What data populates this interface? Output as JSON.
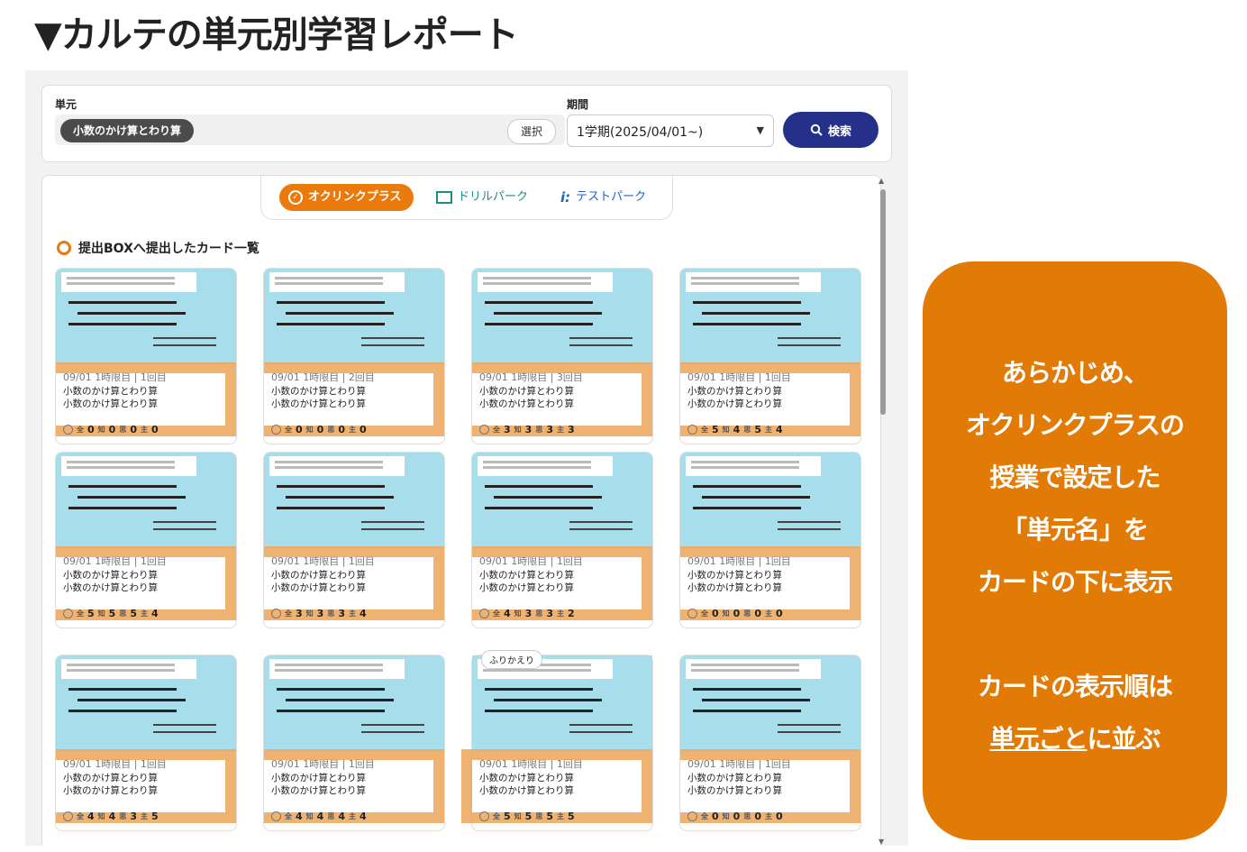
{
  "page_title": "▼カルテの単元別学習レポート",
  "search": {
    "unit_label": "単元",
    "unit_chip": "小数のかけ算とわり算",
    "select_button": "選択",
    "period_label": "期間",
    "period_value": "1学期(2025/04/01~)",
    "search_button": "検索"
  },
  "tabs": [
    {
      "label": "オクリンクプラス",
      "active": true
    },
    {
      "label": "ドリルパーク",
      "active": false
    },
    {
      "label": "テストパーク",
      "active": false
    }
  ],
  "section_title": "提出BOXへ提出したカード一覧",
  "score_labels": {
    "all": "全",
    "chi": "知",
    "shi": "思",
    "shu": "主"
  },
  "cards": [
    {
      "meta": "09/01 1時限目 | 1回目",
      "unit1": "小数のかけ算とわり算",
      "unit2": "小数のかけ算とわり算",
      "s_all": "0",
      "s_chi": "0",
      "s_shi": "0",
      "s_shu": "0"
    },
    {
      "meta": "09/01 1時限目 | 2回目",
      "unit1": "小数のかけ算とわり算",
      "unit2": "小数のかけ算とわり算",
      "s_all": "0",
      "s_chi": "0",
      "s_shi": "0",
      "s_shu": "0"
    },
    {
      "meta": "09/01 1時限目 | 3回目",
      "unit1": "小数のかけ算とわり算",
      "unit2": "小数のかけ算とわり算",
      "s_all": "3",
      "s_chi": "3",
      "s_shi": "3",
      "s_shu": "3"
    },
    {
      "meta": "09/01 1時限目 | 1回目",
      "unit1": "小数のかけ算とわり算",
      "unit2": "小数のかけ算とわり算",
      "s_all": "5",
      "s_chi": "4",
      "s_shi": "5",
      "s_shu": "4"
    },
    {
      "meta": "09/01 1時限目 | 1回目",
      "unit1": "小数のかけ算とわり算",
      "unit2": "小数のかけ算とわり算",
      "s_all": "5",
      "s_chi": "5",
      "s_shi": "5",
      "s_shu": "4"
    },
    {
      "meta": "09/01 1時限目 | 1回目",
      "unit1": "小数のかけ算とわり算",
      "unit2": "小数のかけ算とわり算",
      "s_all": "3",
      "s_chi": "3",
      "s_shi": "3",
      "s_shu": "4"
    },
    {
      "meta": "09/01 1時限目 | 1回目",
      "unit1": "小数のかけ算とわり算",
      "unit2": "小数のかけ算とわり算",
      "s_all": "4",
      "s_chi": "3",
      "s_shi": "3",
      "s_shu": "2"
    },
    {
      "meta": "09/01 1時限目 | 1回目",
      "unit1": "小数のかけ算とわり算",
      "unit2": "小数のかけ算とわり算",
      "s_all": "0",
      "s_chi": "0",
      "s_shi": "0",
      "s_shu": "0"
    },
    {
      "meta": "09/01 1時限目 | 1回目",
      "unit1": "小数のかけ算とわり算",
      "unit2": "小数のかけ算とわり算",
      "s_all": "4",
      "s_chi": "4",
      "s_shi": "3",
      "s_shu": "5"
    },
    {
      "meta": "09/01 1時限目 | 1回目",
      "unit1": "小数のかけ算とわり算",
      "unit2": "小数のかけ算とわり算",
      "s_all": "4",
      "s_chi": "4",
      "s_shi": "4",
      "s_shu": "4"
    },
    {
      "meta": "09/01 1時限目 | 1回目",
      "unit1": "小数のかけ算とわり算",
      "unit2": "小数のかけ算とわり算",
      "s_all": "5",
      "s_chi": "5",
      "s_shi": "5",
      "s_shu": "5",
      "badge": "ふりかえり"
    },
    {
      "meta": "09/01 1時限目 | 1回目",
      "unit1": "小数のかけ算とわり算",
      "unit2": "小数のかけ算とわり算",
      "s_all": "0",
      "s_chi": "0",
      "s_shi": "0",
      "s_shu": "0"
    }
  ],
  "callout": {
    "line1": "あらかじめ、",
    "line2": "オクリンクプラスの",
    "line3": "授業で設定した",
    "line4": "「単元名」を",
    "line5": "カードの下に表示",
    "line6": "カードの表示順は",
    "line7_underlined": "単元ごと",
    "line7_rest": "に並ぶ"
  },
  "colors": {
    "accent_orange": "#e27a06",
    "search_button": "#25308a",
    "card_thumb": "#a8ddec",
    "highlight": "#eca558"
  }
}
